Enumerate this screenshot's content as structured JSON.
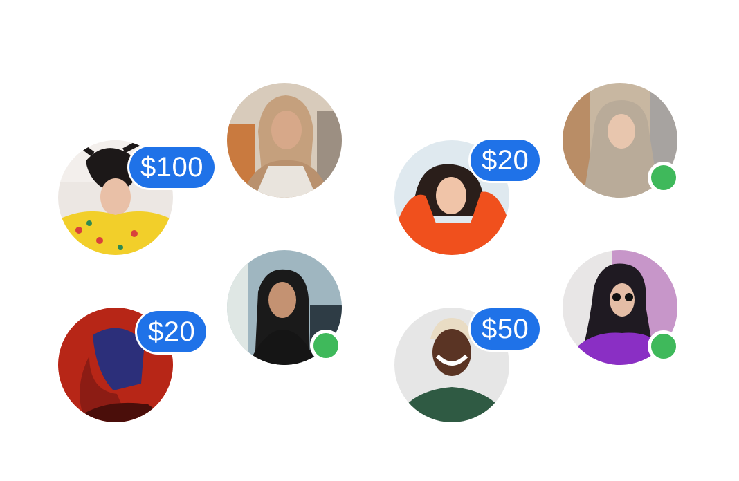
{
  "profiles": [
    {
      "badge": "$100"
    },
    {
      "badge": ""
    },
    {
      "badge": "$20"
    },
    {
      "badge": ""
    },
    {
      "badge": "$20"
    },
    {
      "badge": ""
    },
    {
      "badge": "$50"
    },
    {
      "badge": ""
    }
  ],
  "colors": {
    "badge_blue": "#1f72e8",
    "online_green": "#3fb95b",
    "background": "#ffffff"
  }
}
